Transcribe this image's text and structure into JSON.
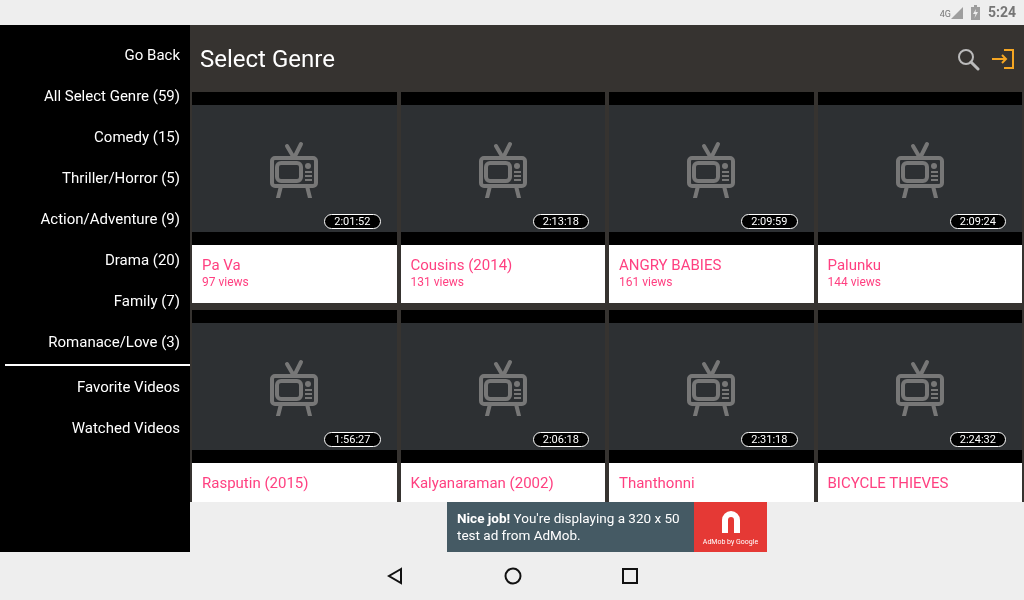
{
  "status_bar": {
    "network": "4G",
    "time": "5:24"
  },
  "sidebar": {
    "items": [
      {
        "label": "Go Back",
        "selected": false
      },
      {
        "label": "All Select Genre (59)",
        "selected": false
      },
      {
        "label": "Comedy (15)",
        "selected": false
      },
      {
        "label": "Thriller/Horror (5)",
        "selected": false
      },
      {
        "label": "Action/Adventure (9)",
        "selected": false
      },
      {
        "label": "Drama (20)",
        "selected": false
      },
      {
        "label": "Family (7)",
        "selected": false
      },
      {
        "label": "Romanace/Love (3)",
        "selected": false
      }
    ],
    "extra_items": [
      {
        "label": "Favorite Videos"
      },
      {
        "label": "Watched Videos"
      }
    ]
  },
  "header": {
    "title": "Select Genre"
  },
  "videos": [
    {
      "title": "Pa Va",
      "views": "97 views",
      "duration": "2:01:52"
    },
    {
      "title": "Cousins (2014)",
      "views": "131 views",
      "duration": "2:13:18"
    },
    {
      "title": "ANGRY BABIES",
      "views": "161 views",
      "duration": "2:09:59"
    },
    {
      "title": "Palunku",
      "views": "144 views",
      "duration": "2:09:24"
    },
    {
      "title": "Rasputin (2015)",
      "duration": "1:56:27"
    },
    {
      "title": "Kalyanaraman (2002)",
      "duration": "2:06:18"
    },
    {
      "title": "Thanthonni",
      "duration": "2:31:18"
    },
    {
      "title": "BICYCLE THIEVES",
      "duration": "2:24:32"
    }
  ],
  "ad": {
    "text": "**Nice job!** You're displaying a 320 x 50 test ad from AdMob.",
    "brand": "AdMob by Google"
  }
}
